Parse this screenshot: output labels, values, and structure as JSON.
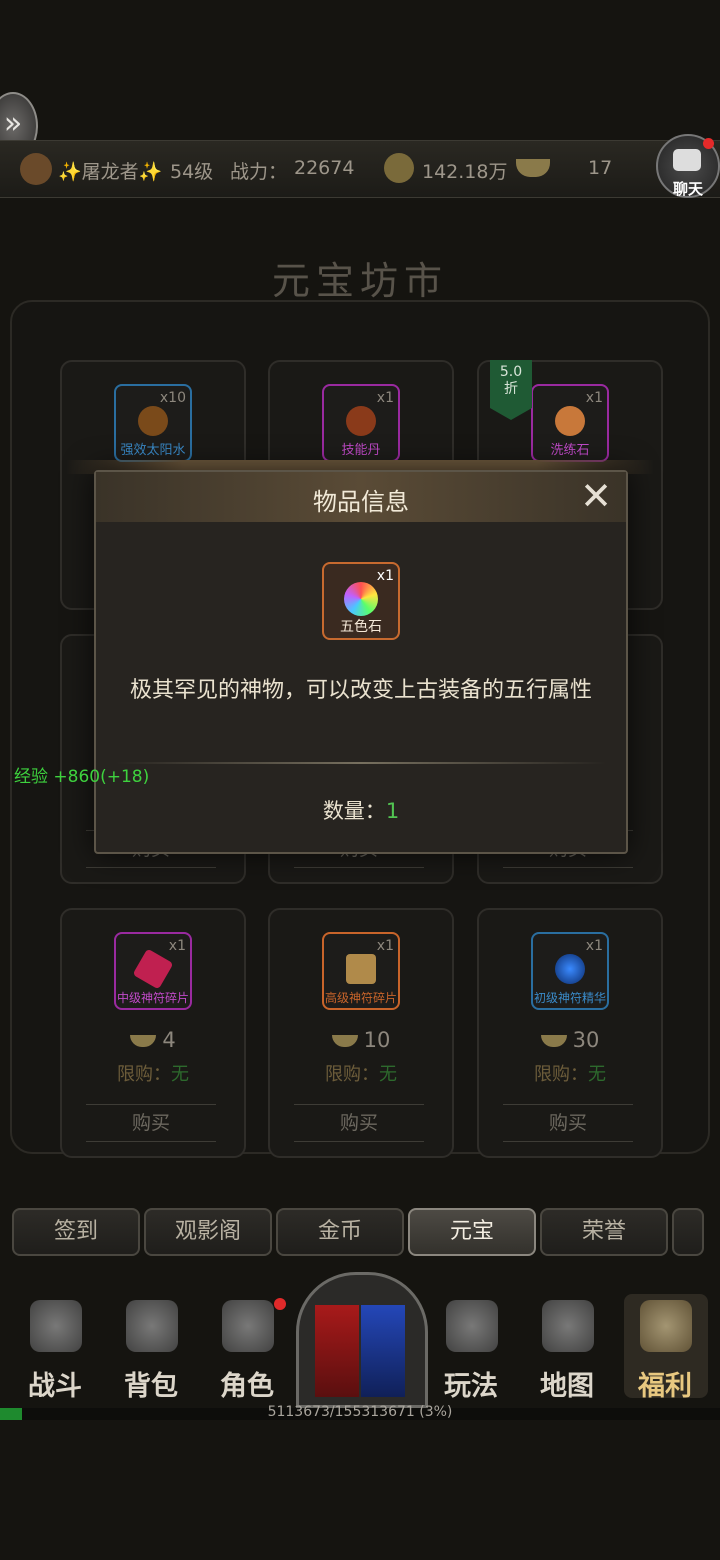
{
  "topbar": {
    "player_name": "✨屠龙者✨",
    "level": "54级",
    "power_label": "战力：",
    "power": "22674",
    "gold": "142.18万",
    "ingots": "17",
    "chat_label": "聊天"
  },
  "market": {
    "title": "元宝坊市",
    "discount": "5.0\n折",
    "discount_line1": "5.0",
    "discount_line2": "折"
  },
  "cards": [
    {
      "name": "强效太阳水",
      "qty": "x10",
      "color": "#2a6ea0",
      "orb": "#7a4a1a"
    },
    {
      "name": "技能丹",
      "qty": "x1",
      "color": "#9a2aa0",
      "orb": "#8a3a1a"
    },
    {
      "name": "洗练石",
      "qty": "x1",
      "color": "#9a2aa0",
      "orb": "#c8783a"
    },
    {
      "name": "中级神符碎片",
      "qty": "x1",
      "color": "#9a2aa0",
      "orb": "#c02050",
      "price": "4",
      "limit_label": "限购：",
      "limit_value": "无",
      "buy": "购买"
    },
    {
      "name": "高级神符碎片",
      "qty": "x1",
      "color": "#c8642a",
      "orb": "#b08a4a",
      "price": "10",
      "limit_label": "限购：",
      "limit_value": "无",
      "buy": "购买"
    },
    {
      "name": "初级神符精华",
      "qty": "x1",
      "color": "#2a6ea0",
      "orb": "#1a60d0",
      "price": "30",
      "limit_label": "限购：",
      "limit_value": "无",
      "buy": "购买"
    }
  ],
  "hidden_buy": "购买",
  "modal": {
    "title": "物品信息",
    "close_glyph": "✕",
    "item_name": "五色石",
    "item_qty": "x1",
    "description": "极其罕见的神物，可以改变上古装备的五行属性",
    "amount_label": "数量：",
    "amount": "1"
  },
  "exp_gain": "经验 +860(+18)",
  "tabs": [
    "签到",
    "观影阁",
    "金币",
    "元宝",
    "荣誉"
  ],
  "active_tab": "元宝",
  "nav": [
    "战斗",
    "背包",
    "角色",
    "玩法",
    "地图",
    "福利"
  ],
  "xp": {
    "text": "5113673/155313671 (3%)",
    "fraction": 0.03
  }
}
